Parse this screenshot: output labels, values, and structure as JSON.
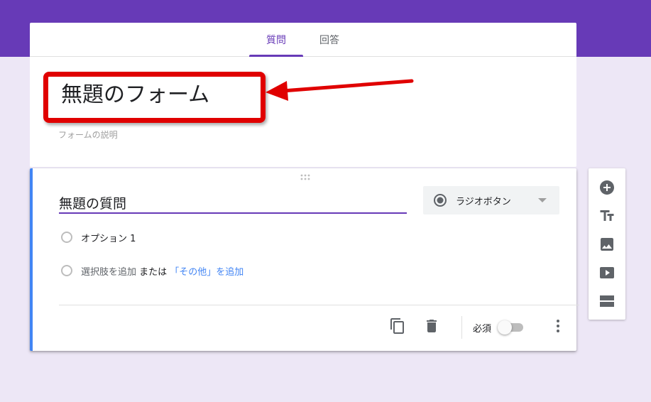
{
  "tabs": {
    "questions": "質問",
    "responses": "回答"
  },
  "form": {
    "title": "無題のフォーム",
    "description": "フォームの説明"
  },
  "question": {
    "title": "無題の質問",
    "type_label": "ラジオボタン",
    "option1": "オプション 1",
    "add_option": "選択肢を追加",
    "or": " または ",
    "add_other": "「その他」を追加",
    "required_label": "必須"
  },
  "colors": {
    "accent": "#673ab7",
    "background": "#ede7f6",
    "active_border": "#4285f4",
    "highlight": "#e00000"
  },
  "icons": {
    "copy": "copy-icon",
    "trash": "trash-icon",
    "more": "more-vert-icon",
    "add": "add-circle-icon",
    "title": "text-fields-icon",
    "image": "image-icon",
    "video": "video-icon",
    "section": "section-icon"
  }
}
